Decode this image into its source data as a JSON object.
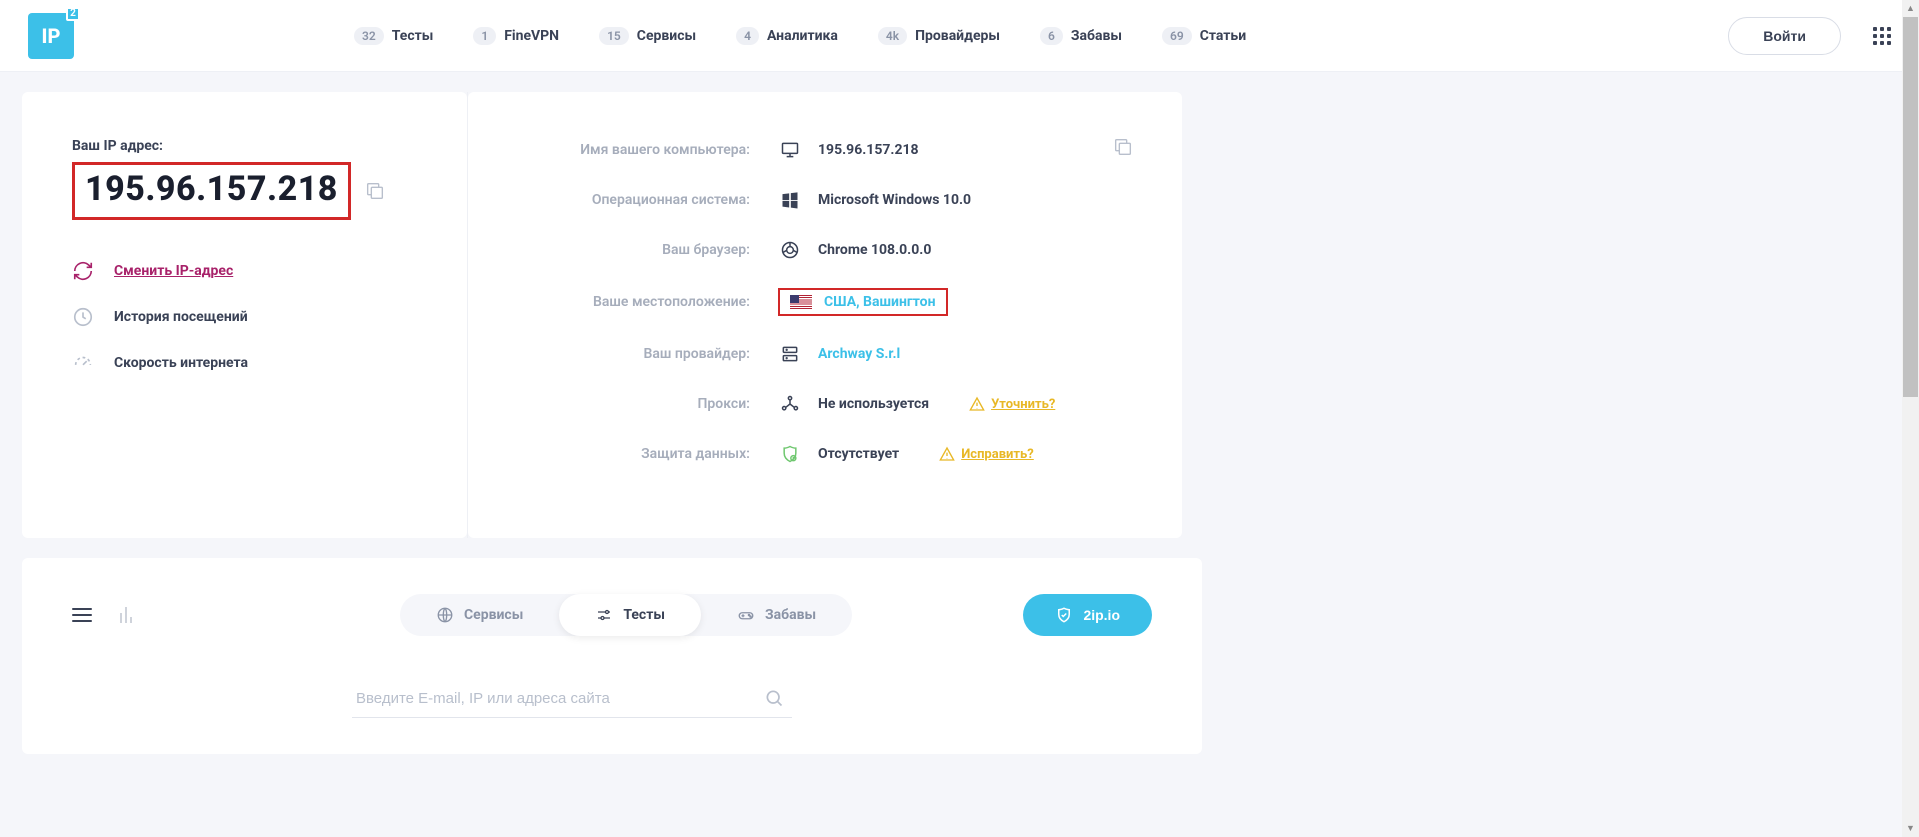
{
  "header": {
    "logo_text": "IP",
    "logo_badge": "2",
    "nav": [
      {
        "count": "32",
        "label": "Тесты"
      },
      {
        "count": "1",
        "label": "FineVPN"
      },
      {
        "count": "15",
        "label": "Сервисы"
      },
      {
        "count": "4",
        "label": "Аналитика"
      },
      {
        "count": "4k",
        "label": "Провайдеры"
      },
      {
        "count": "6",
        "label": "Забавы"
      },
      {
        "count": "69",
        "label": "Статьи"
      }
    ],
    "login": "Войти"
  },
  "left": {
    "ip_label": "Ваш IP адрес:",
    "ip_value": "195.96.157.218",
    "actions": {
      "change_ip": "Сменить IP-адрес",
      "history": "История посещений",
      "speed": "Скорость интернета"
    }
  },
  "info": {
    "computer_label": "Имя вашего компьютера:",
    "computer_value": "195.96.157.218",
    "os_label": "Операционная система:",
    "os_value": "Microsoft Windows 10.0",
    "browser_label": "Ваш браузер:",
    "browser_value": "Chrome 108.0.0.0",
    "location_label": "Ваше местоположение:",
    "location_value": "США, Вашингтон",
    "provider_label": "Ваш провайдер:",
    "provider_value": "Archway S.r.l",
    "proxy_label": "Прокси:",
    "proxy_value": "Не используется",
    "proxy_link": "Уточнить?",
    "protect_label": "Защита данных:",
    "protect_value": "Отсутствует",
    "protect_link": "Исправить?"
  },
  "bottom": {
    "pills": {
      "services": "Сервисы",
      "tests": "Тесты",
      "fun": "Забавы"
    },
    "promo": "2ip.io",
    "search_placeholder": "Введите E-mail, IP или адреса сайта"
  }
}
